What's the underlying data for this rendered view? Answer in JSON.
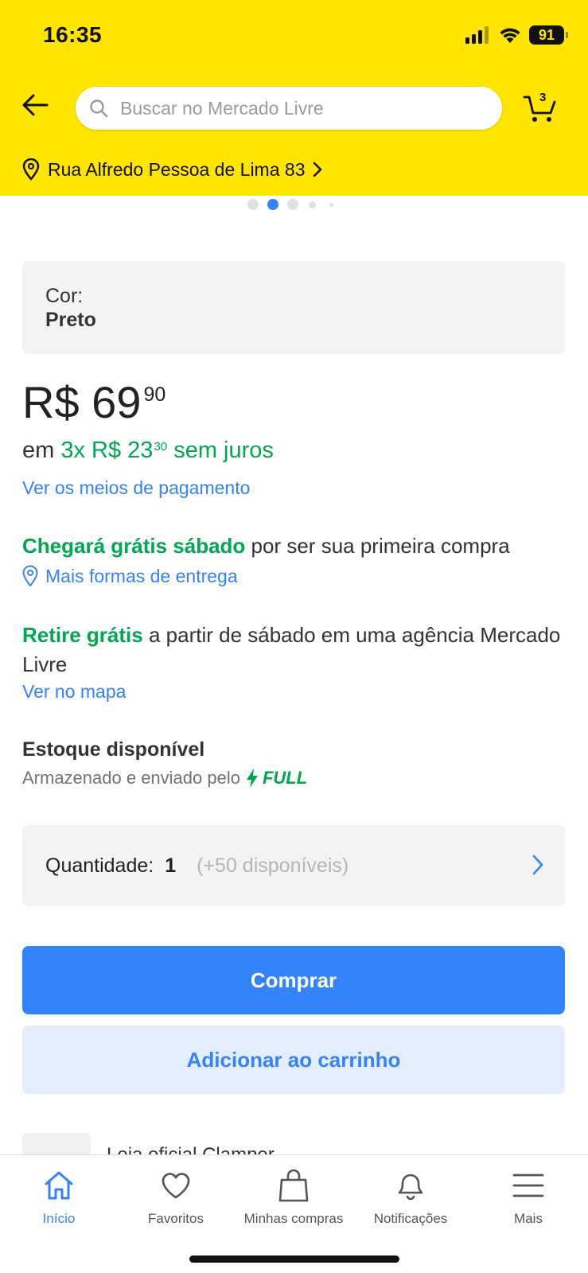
{
  "status_bar": {
    "time": "16:35",
    "battery": "91"
  },
  "header": {
    "search_placeholder": "Buscar no Mercado Livre",
    "cart_count": "3",
    "address": "Rua Alfredo Pessoa de Lima 83"
  },
  "carousel": {
    "total_dots_visible": 5,
    "active_index": 1
  },
  "product": {
    "color_label": "Cor:",
    "color_value": "Preto",
    "price_main": "R$ 69",
    "price_cents": "90",
    "installments_prefix": "em",
    "installments_main": "3x R$ 23",
    "installments_cents": "30",
    "installments_suffix": "sem juros",
    "payment_link": "Ver os meios de pagamento"
  },
  "shipping": {
    "arrival_highlight": "Chegará grátis sábado",
    "arrival_rest": "por ser sua primeira compra",
    "more_options_link": "Mais formas de entrega",
    "pickup_highlight": "Retire grátis",
    "pickup_rest": "a partir de sábado em uma agência Mercado Livre",
    "map_link": "Ver no mapa"
  },
  "stock": {
    "title": "Estoque disponível",
    "subtitle": "Armazenado e enviado pelo",
    "full_badge": "FULL"
  },
  "quantity": {
    "label": "Quantidade:",
    "value": "1",
    "available": "(+50 disponíveis)"
  },
  "actions": {
    "buy": "Comprar",
    "add_to_cart": "Adicionar ao carrinho"
  },
  "store_peek": {
    "text": "Loja oficial Clamper"
  },
  "bottom_nav": {
    "items": [
      {
        "label": "Início",
        "icon": "home-icon",
        "active": true
      },
      {
        "label": "Favoritos",
        "icon": "heart-icon",
        "active": false
      },
      {
        "label": "Minhas compras",
        "icon": "shopping-bag-icon",
        "active": false
      },
      {
        "label": "Notificações",
        "icon": "bell-icon",
        "active": false
      },
      {
        "label": "Mais",
        "icon": "menu-icon",
        "active": false
      }
    ]
  },
  "colors": {
    "header_yellow": "#FFE600",
    "accent_blue": "#3483FA",
    "success_green": "#00A650",
    "light_blue_button": "#E3EDFB",
    "panel_gray": "#F3F3F3"
  }
}
